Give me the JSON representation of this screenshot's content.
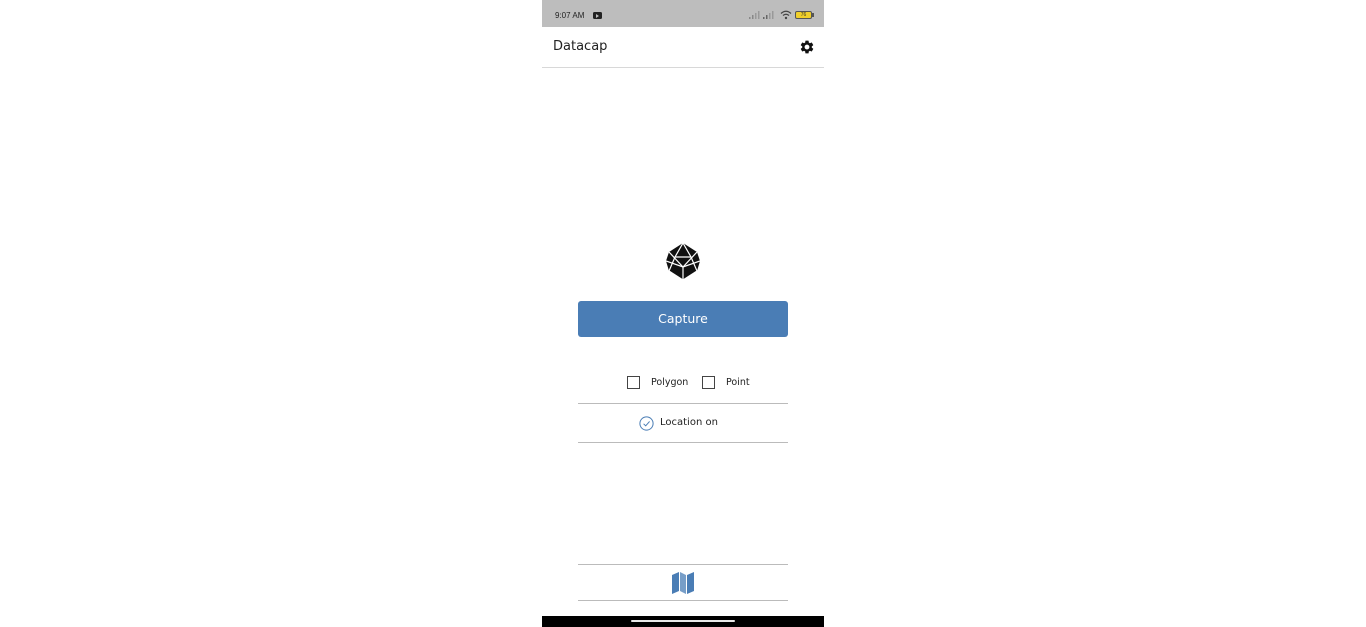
{
  "status_bar": {
    "time": "9:07 AM",
    "battery_level": "76"
  },
  "app_bar": {
    "title": "Datacap",
    "settings_icon": "gear-icon"
  },
  "main": {
    "logo_icon": "polyhedron-logo-icon",
    "capture_label": "Capture",
    "geometry_options": [
      {
        "label": "Polygon",
        "checked": false
      },
      {
        "label": "Point",
        "checked": false
      }
    ],
    "location_label": "Location on",
    "location_status_icon": "check-circle-icon"
  },
  "bottom": {
    "map_icon": "map-icon"
  },
  "colors": {
    "accent": "#4a7db5",
    "status_bar": "#bdbdbd",
    "battery": "#f0cf2a"
  }
}
